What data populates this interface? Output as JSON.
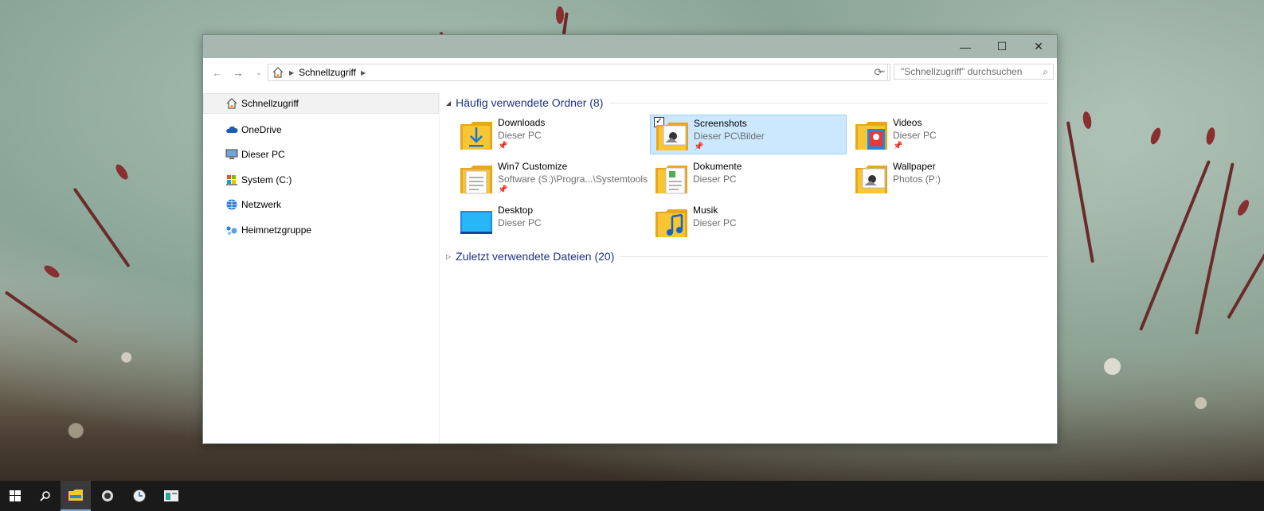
{
  "window": {
    "controls": {
      "minimize": "—",
      "maximize": "☐",
      "close": "✕"
    }
  },
  "toolbar": {
    "back_icon": "←",
    "forward_icon": "→",
    "recent_icon": "⌄",
    "breadcrumb": "Schnellzugriff",
    "search_placeholder": "\"Schnellzugriff\" durchsuchen"
  },
  "sidebar": {
    "items": [
      {
        "label": "Schnellzugriff",
        "icon": "home-icon"
      },
      {
        "label": "OneDrive",
        "icon": "cloud-icon"
      },
      {
        "label": "Dieser PC",
        "icon": "computer-icon"
      },
      {
        "label": "System (C:)",
        "icon": "drive-icon"
      },
      {
        "label": "Netzwerk",
        "icon": "network-icon"
      },
      {
        "label": "Heimnetzgruppe",
        "icon": "homegroup-icon"
      }
    ]
  },
  "groups": {
    "frequent": {
      "title": "Häufig verwendete Ordner (8)"
    },
    "recent": {
      "title": "Zuletzt verwendete Dateien (20)"
    }
  },
  "folders": [
    {
      "name": "Downloads",
      "path": "Dieser PC",
      "pinned": true,
      "icon": "downloads-folder-icon"
    },
    {
      "name": "Screenshots",
      "path": "Dieser PC\\Bilder",
      "pinned": true,
      "icon": "pictures-folder-icon"
    },
    {
      "name": "Videos",
      "path": "Dieser PC",
      "pinned": true,
      "icon": "videos-folder-icon"
    },
    {
      "name": "Win7 Customize",
      "path": "Software (S:)\\Progra...\\Systemtools",
      "pinned": true,
      "icon": "documents-folder-icon"
    },
    {
      "name": "Dokumente",
      "path": "Dieser PC",
      "pinned": false,
      "icon": "documents-folder-icon"
    },
    {
      "name": "Wallpaper",
      "path": "Photos (P:)",
      "pinned": false,
      "icon": "pictures-folder-icon"
    },
    {
      "name": "Desktop",
      "path": "Dieser PC",
      "pinned": false,
      "icon": "desktop-folder-icon"
    },
    {
      "name": "Musik",
      "path": "Dieser PC",
      "pinned": false,
      "icon": "music-folder-icon"
    }
  ],
  "colors": {
    "accent": "#1e3287",
    "selection": "#cce8ff",
    "folder": "#f8c533"
  }
}
